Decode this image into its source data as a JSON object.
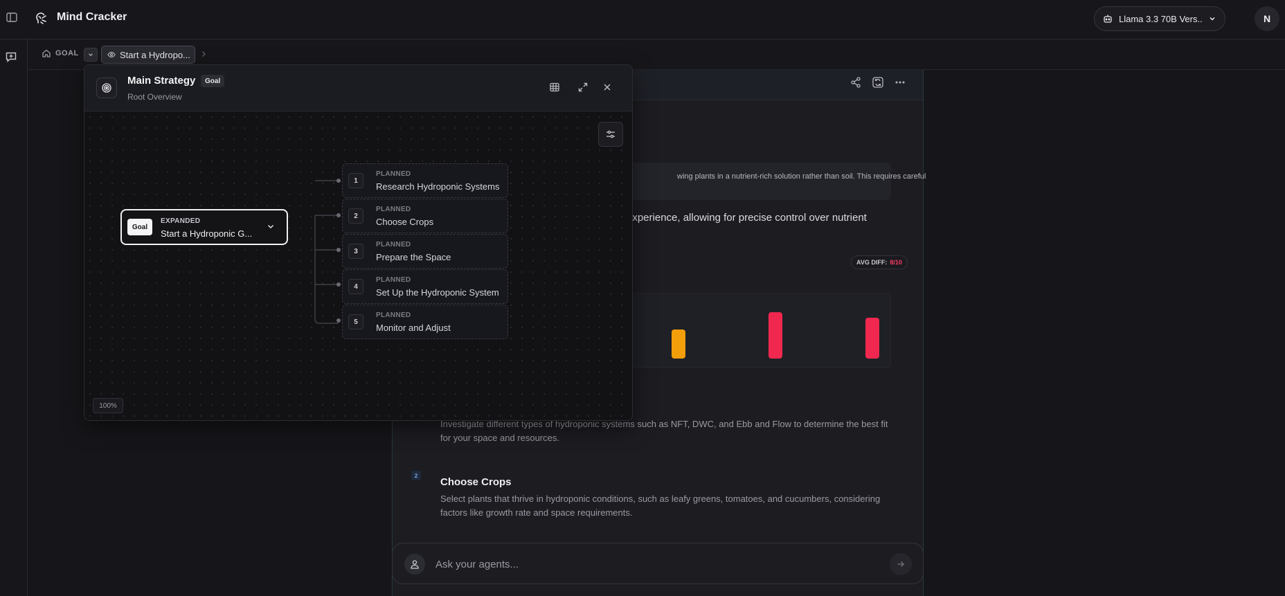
{
  "app": {
    "title": "Mind Cracker",
    "model_selector": "Llama 3.3 70B Vers...",
    "user_initial": "N"
  },
  "breadcrumb": {
    "root": "GOAL",
    "current": "Start a Hydropo..."
  },
  "main_card": {
    "description_fragment": "wing plants in a nutrient-rich solution rather than soil. This requires careful",
    "paragraph_fragment": "experience, allowing for precise control over nutrient",
    "avg_diff_label": "AVG DIFF:",
    "avg_diff_value": "8/10",
    "difficulty_bars": [
      {
        "value": 5,
        "color": "#f59e0b"
      },
      {
        "value": 8,
        "color": "#f0284f"
      },
      {
        "value": 7,
        "color": "#f0284f"
      }
    ],
    "tasks": [
      {
        "number": "1",
        "title": "Research Hydroponic Systems",
        "description": "Investigate different types of hydroponic systems such as NFT, DWC, and Ebb and Flow to determine the best fit for your space and resources."
      },
      {
        "number": "2",
        "title": "Choose Crops",
        "description": "Select plants that thrive in hydroponic conditions, such as leafy greens, tomatoes, and cucumbers, considering factors like growth rate and space requirements."
      }
    ]
  },
  "composer": {
    "placeholder": "Ask your agents..."
  },
  "panel": {
    "title": "Main Strategy",
    "badge": "Goal",
    "subtitle": "Root Overview",
    "zoom": "100%",
    "root_node": {
      "chip": "Goal",
      "status": "EXPANDED",
      "label": "Start a Hydroponic G..."
    },
    "children": [
      {
        "number": "1",
        "status": "PLANNED",
        "label": "Research Hydroponic Systems"
      },
      {
        "number": "2",
        "status": "PLANNED",
        "label": "Choose Crops"
      },
      {
        "number": "3",
        "status": "PLANNED",
        "label": "Prepare the Space"
      },
      {
        "number": "4",
        "status": "PLANNED",
        "label": "Set Up the Hydroponic System"
      },
      {
        "number": "5",
        "status": "PLANNED",
        "label": "Monitor and Adjust"
      }
    ]
  },
  "colors": {
    "accent_danger": "#f0284f",
    "accent_warning": "#f59e0b",
    "background": "#16161a"
  }
}
